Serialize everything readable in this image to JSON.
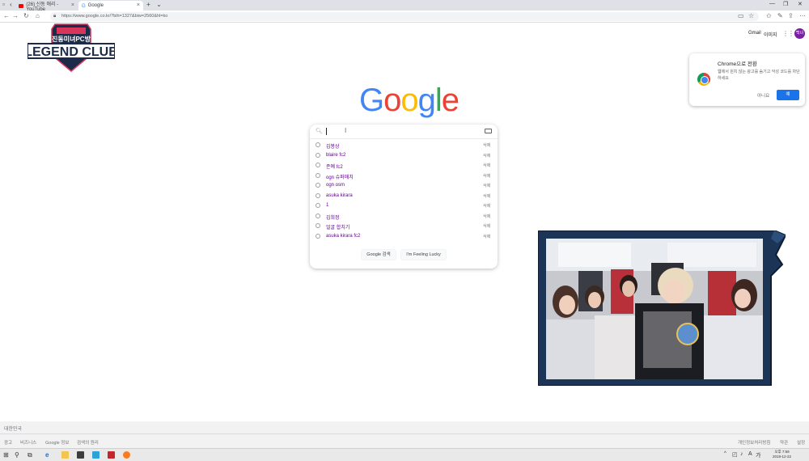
{
  "browser": {
    "tabs": [
      {
        "label": "(26) 신동 애리 - YouTube",
        "favicon_color": "#ff0000"
      },
      {
        "label": "Google",
        "favicon_color": "#4285f4"
      }
    ],
    "new_tab_glyph": "+",
    "url": "https://www.google.co.kr/?bih=1327&biw=2560&hl=ko"
  },
  "overlay_logo": {
    "line1": "진동미녀PC방",
    "line2": "LEGEND CLUB"
  },
  "google": {
    "top_links": {
      "gmail": "Gmail",
      "images": "이미지",
      "avatar": "백녀"
    },
    "logo_letters": [
      {
        "ch": "G",
        "color": "#4285f4"
      },
      {
        "ch": "o",
        "color": "#ea4335"
      },
      {
        "ch": "o",
        "color": "#fbbc05"
      },
      {
        "ch": "g",
        "color": "#4285f4"
      },
      {
        "ch": "l",
        "color": "#34a853"
      },
      {
        "ch": "e",
        "color": "#ea4335"
      }
    ],
    "suggestions": [
      {
        "text": "김봉상",
        "delete": "삭제"
      },
      {
        "text": "blaire fc2",
        "delete": "삭제"
      },
      {
        "text": "존예 fc2",
        "delete": "삭제"
      },
      {
        "text": "ogn 슈퍼매치",
        "delete": "삭제"
      },
      {
        "text": "ogn osm",
        "delete": "삭제"
      },
      {
        "text": "asuka kirara",
        "delete": "삭제"
      },
      {
        "text": "1",
        "delete": "삭제"
      },
      {
        "text": "김희정",
        "delete": "삭제"
      },
      {
        "text": "얼굴 합치기",
        "delete": "삭제"
      },
      {
        "text": "asuka kirara fc2",
        "delete": "삭제"
      }
    ],
    "buttons": {
      "search": "Google 검색",
      "lucky": "I'm Feeling Lucky"
    }
  },
  "chrome_popup": {
    "title": "Chrome으로 전환",
    "body": "웹에서 원치 않는 광고를 숨기고 악성 코드를 차단하세요",
    "no": "아니요",
    "yes": "예"
  },
  "footer": {
    "country": "대한민국",
    "left_links": [
      "광고",
      "비즈니스",
      "Google 정보",
      "검색의 원리"
    ],
    "right_links": [
      "개인정보처리방침",
      "약관",
      "설정"
    ]
  },
  "taskbar": {
    "ime": "가",
    "time": "오후 7:59",
    "date": "2019-12-22"
  },
  "colors": {
    "accent": "#1a73e8",
    "visited": "#660099",
    "frame_navy": "#1c3557"
  }
}
